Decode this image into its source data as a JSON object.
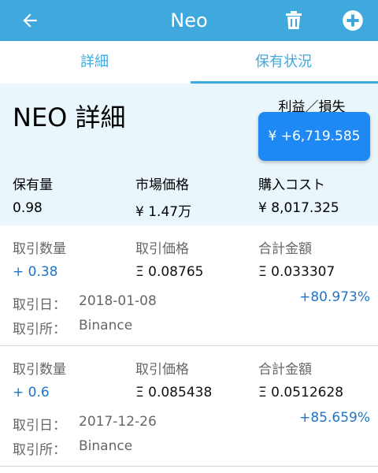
{
  "appbar": {
    "title": "Neo"
  },
  "tabs": [
    "詳細",
    "保有状況"
  ],
  "summary": {
    "title": "NEO 詳細",
    "profit_loss_label": "利益／損失",
    "profit_loss_value": "¥ +6,719.585",
    "stats": [
      {
        "label": "保有量",
        "value": "0.98"
      },
      {
        "label": "市場価格",
        "value": "¥ 1.47万"
      },
      {
        "label": "購入コスト",
        "value": "¥ 8,017.325"
      }
    ]
  },
  "transactions": [
    {
      "qty_label": "取引数量",
      "qty": "+ 0.38",
      "price_label": "取引価格",
      "price": "Ξ 0.08765",
      "total_label": "合計金額",
      "total": "Ξ 0.033307",
      "change": "+80.973%",
      "date_label": "取引日：",
      "date": "2018-01-08",
      "exchange_label": "取引所：",
      "exchange": "Binance"
    },
    {
      "qty_label": "取引数量",
      "qty": "+ 0.6",
      "price_label": "取引価格",
      "price": "Ξ 0.085438",
      "total_label": "合計金額",
      "total": "Ξ 0.0512628",
      "change": "+85.659%",
      "date_label": "取引日：",
      "date": "2017-12-26",
      "exchange_label": "取引所：",
      "exchange": "Binance"
    }
  ],
  "icons": {
    "back": "arrow-left-icon",
    "delete": "trash-icon",
    "add": "plus-circle-icon"
  },
  "colors": {
    "primary": "#3fa9dd",
    "accent": "#1e88f5",
    "summary_bg": "#e9f6fc",
    "positive": "#1e74c8"
  }
}
